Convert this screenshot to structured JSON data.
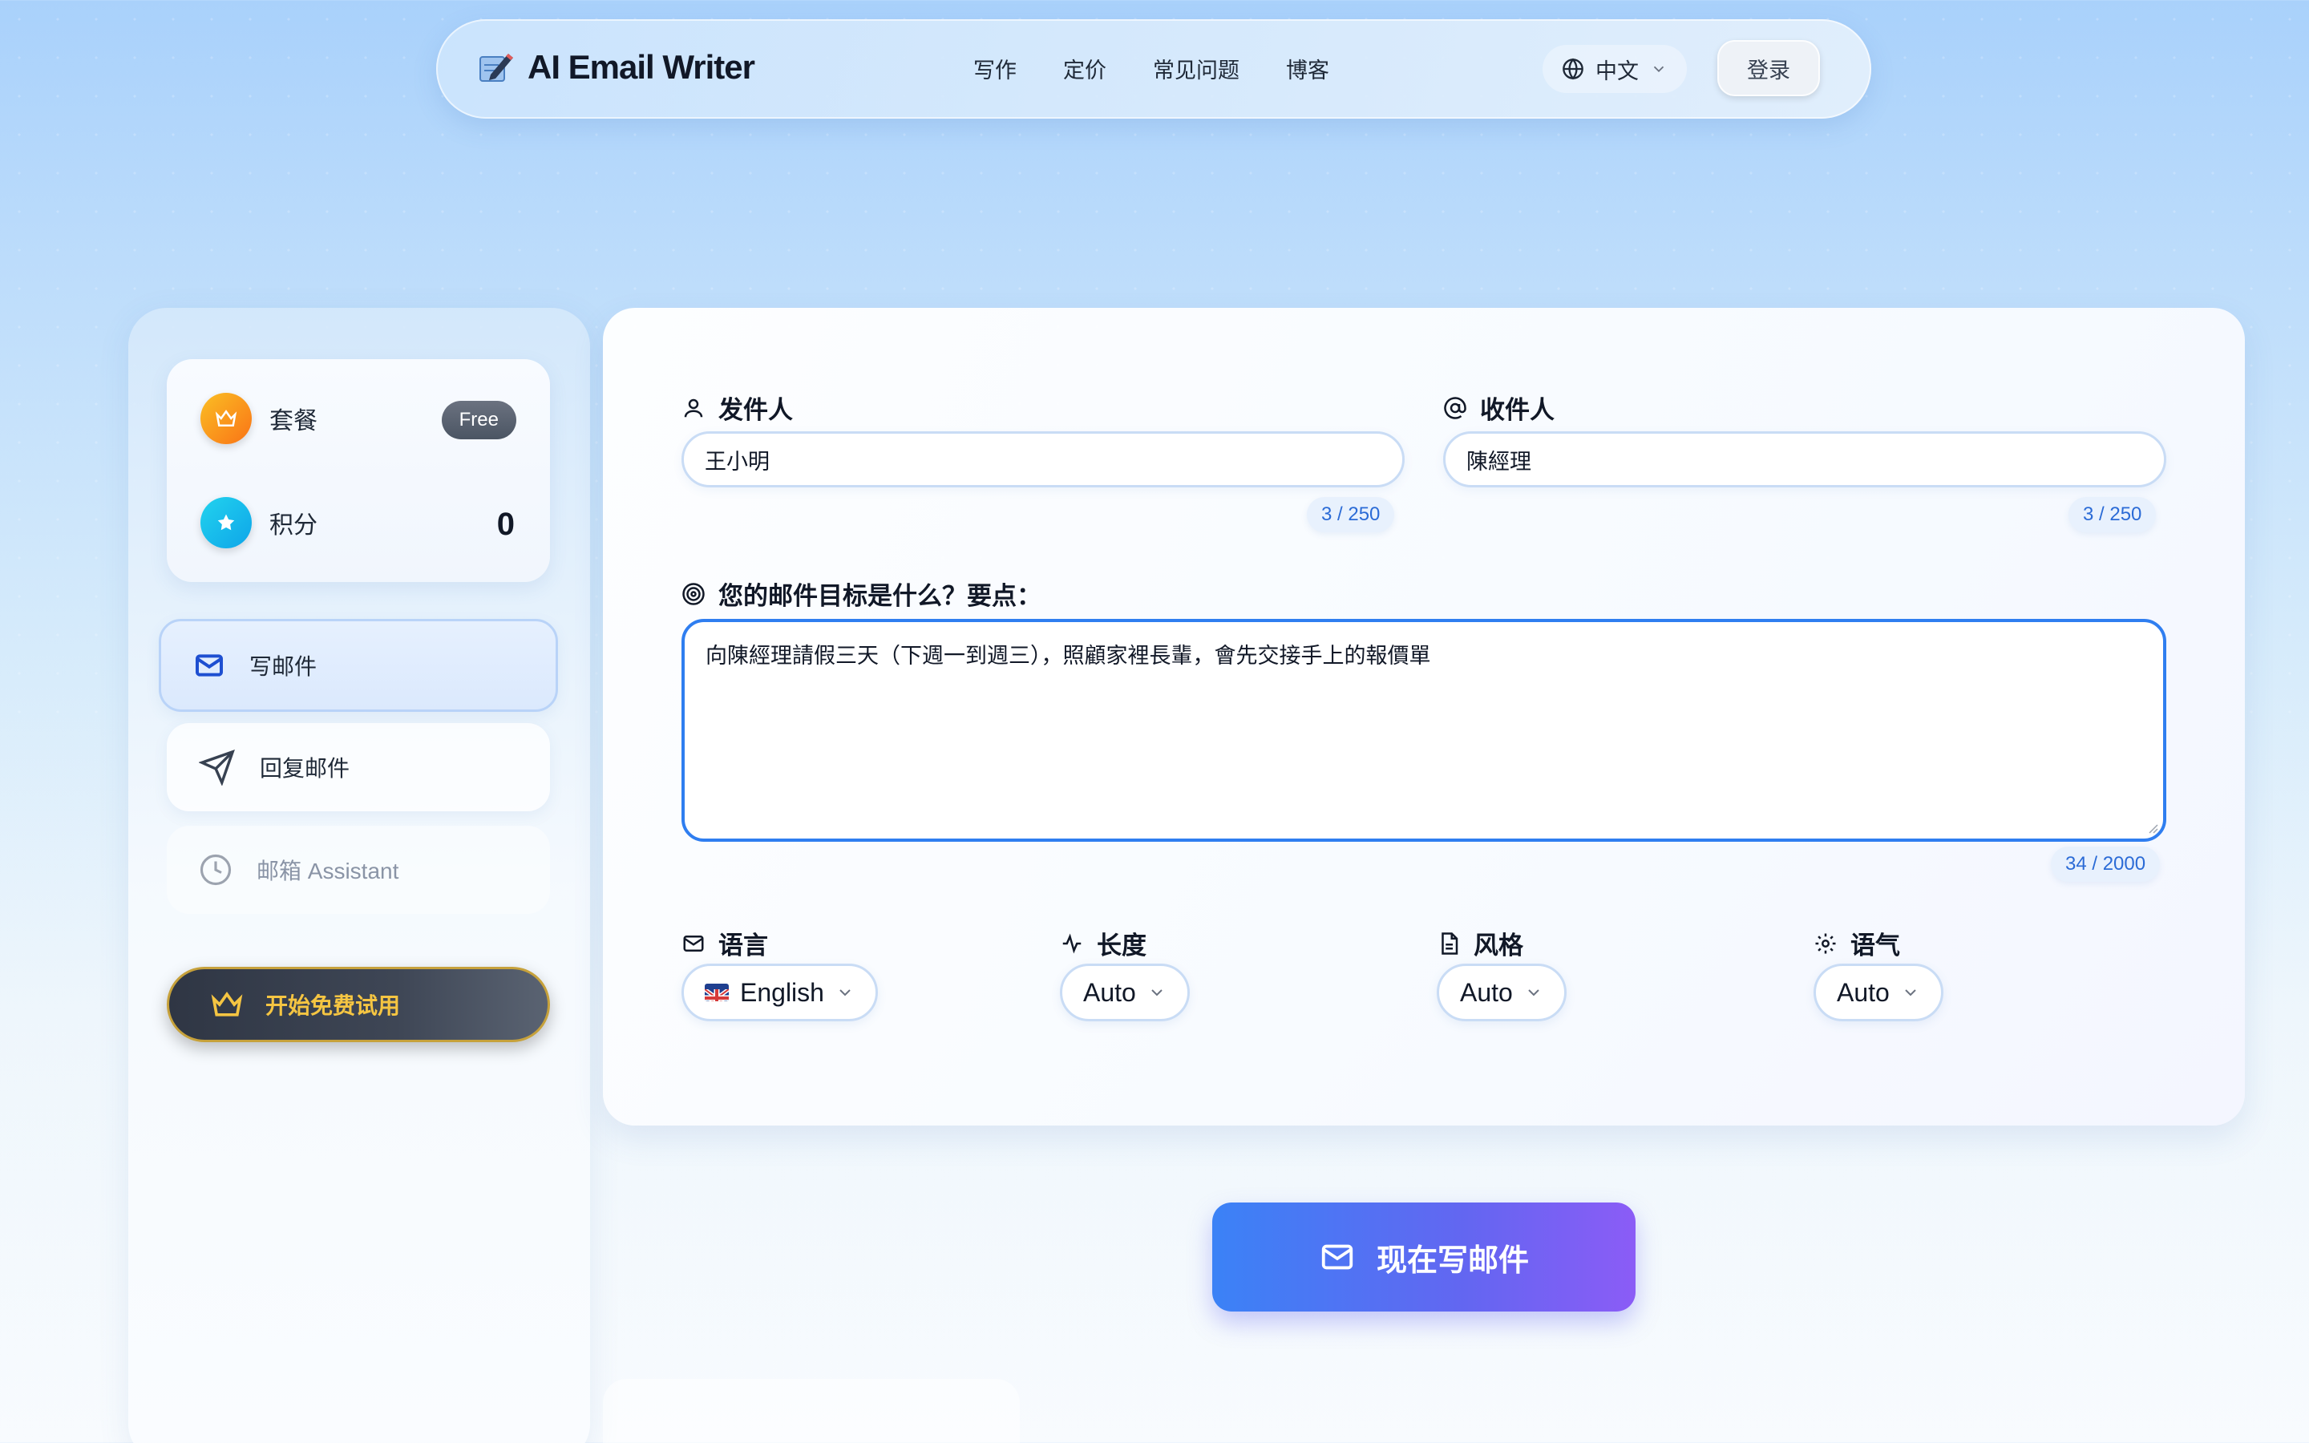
{
  "brand": {
    "name": "AI Email Writer",
    "icon": "pencil-note-icon"
  },
  "nav": {
    "links": [
      "写作",
      "定价",
      "常见问题",
      "博客"
    ],
    "language": "中文",
    "login": "登录"
  },
  "sidebar": {
    "plan_label": "套餐",
    "plan_badge": "Free",
    "points_label": "积分",
    "points_value": "0",
    "items": [
      {
        "label": "写邮件",
        "icon": "mail-icon"
      },
      {
        "label": "回复邮件",
        "icon": "send-icon"
      },
      {
        "label": "邮箱 Assistant",
        "icon": "clock-icon"
      }
    ],
    "trial_button": "开始免费试用"
  },
  "form": {
    "sender_label": "发件人",
    "sender_value": "王小明",
    "sender_count": "3 / 250",
    "recipient_label": "收件人",
    "recipient_value": "陳經理",
    "recipient_count": "3 / 250",
    "goal_label": "您的邮件目标是什么？要点：",
    "goal_value": "向陳經理請假三天（下週一到週三），照顧家裡長輩，會先交接手上的報價單",
    "goal_count": "34 / 2000",
    "options": [
      {
        "label": "语言",
        "value": "English",
        "icon": "mail-icon"
      },
      {
        "label": "长度",
        "value": "Auto",
        "icon": "activity-icon"
      },
      {
        "label": "风格",
        "value": "Auto",
        "icon": "document-icon"
      },
      {
        "label": "语气",
        "value": "Auto",
        "icon": "gear-icon"
      }
    ]
  },
  "submit_label": "现在写邮件",
  "colors": {
    "accent": "#2f7ef0",
    "button_start": "#3b82f6",
    "button_end": "#8b5cf6",
    "gold": "#f5c542"
  }
}
